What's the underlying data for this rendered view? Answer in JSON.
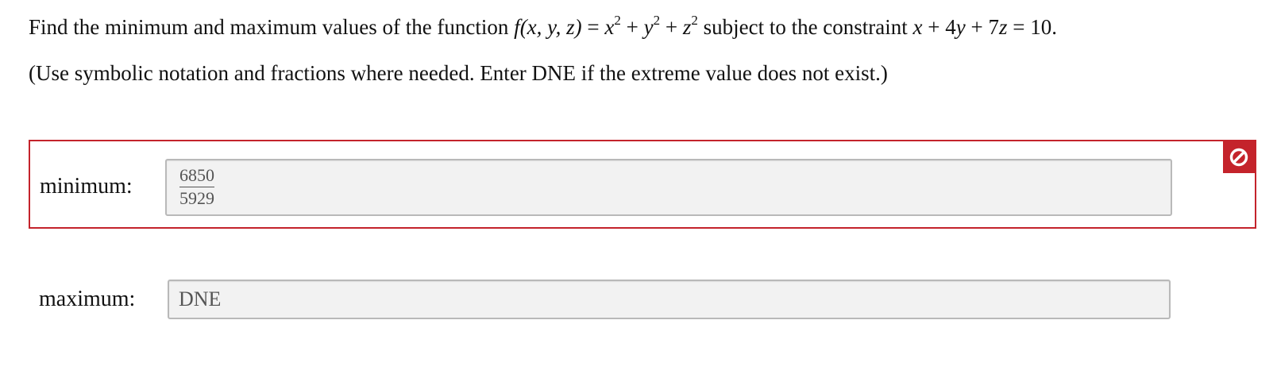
{
  "question": {
    "prefix": "Find the minimum and maximum values of the function",
    "func_name": "f",
    "func_args": "(x, y, z)",
    "equals": "=",
    "term_x": "x",
    "term_y": "y",
    "term_z": "z",
    "exponent": "2",
    "plus": "+",
    "middle": "subject to the constraint",
    "c_x": "x",
    "coef_y": "4",
    "c_y": "y",
    "coef_z": "7",
    "c_z": "z",
    "rhs": "10",
    "end": "."
  },
  "instructions": "(Use symbolic notation and fractions where needed. Enter DNE if the extreme value does not exist.)",
  "minimum": {
    "label": "minimum:",
    "numerator": "6850",
    "denominator": "5929",
    "status": "incorrect",
    "status_icon": "no-entry-icon",
    "status_color": "#c4232b"
  },
  "maximum": {
    "label": "maximum:",
    "value": "DNE"
  }
}
